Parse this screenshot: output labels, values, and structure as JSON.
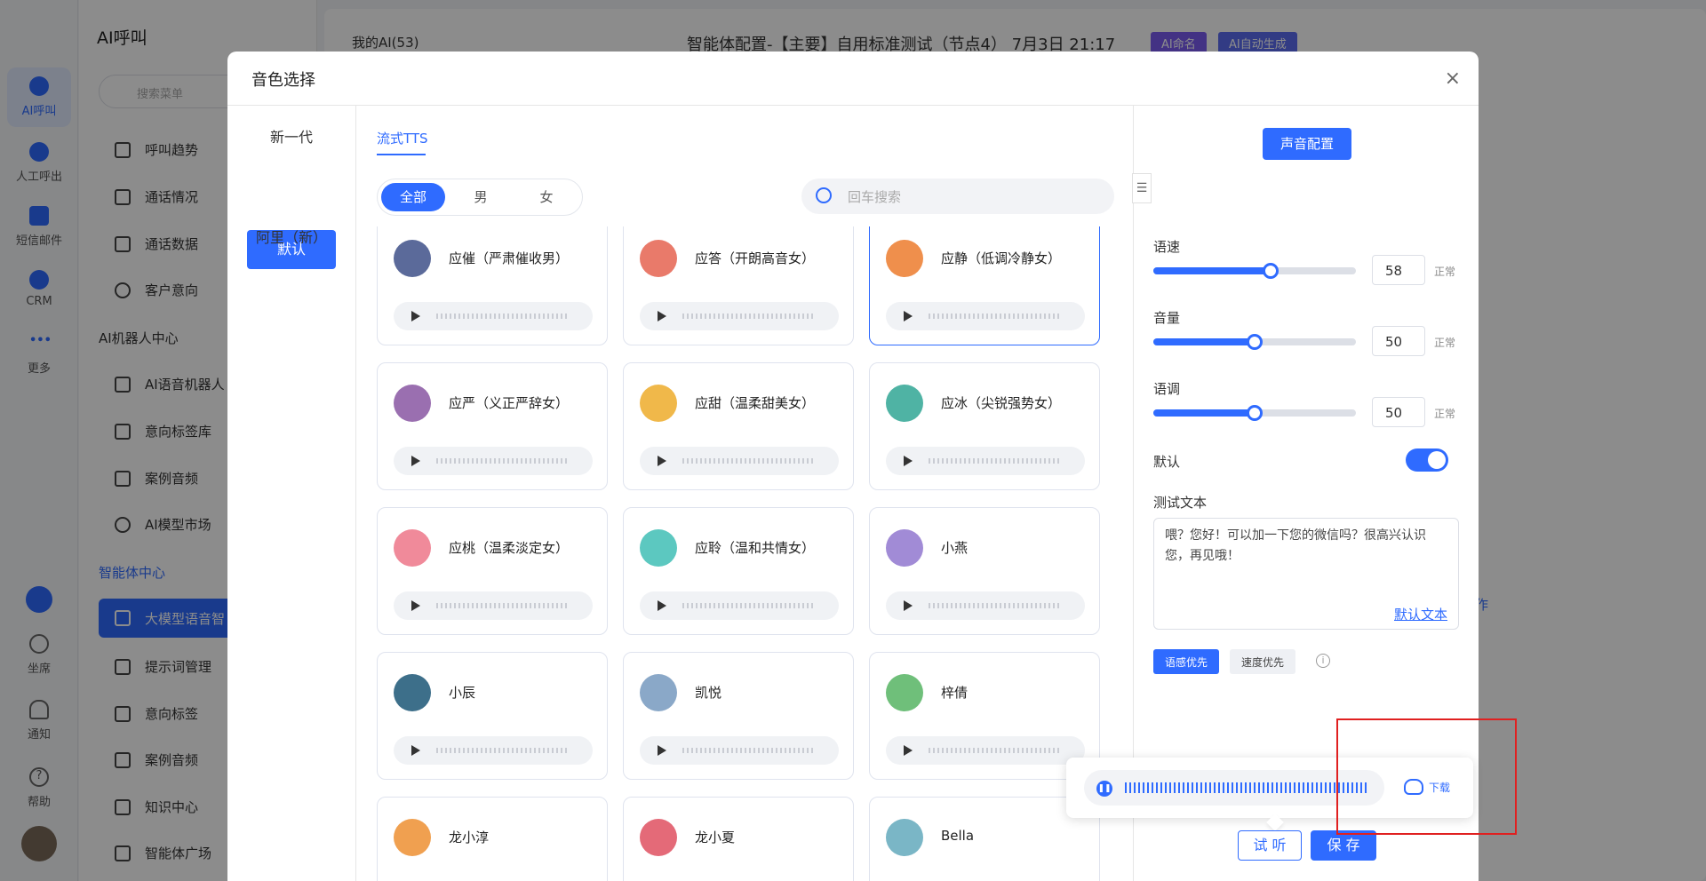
{
  "rail": [
    {
      "label": "AI呼叫",
      "active": true
    },
    {
      "label": "人工呼出"
    },
    {
      "label": "短信邮件"
    },
    {
      "label": "CRM"
    },
    {
      "label": "更多"
    },
    {
      "label": "坐席"
    },
    {
      "label": "通知"
    },
    {
      "label": "帮助"
    }
  ],
  "menu": {
    "title": "AI呼叫",
    "search_placeholder": "搜索菜单",
    "items": [
      "呼叫趋势",
      "通话情况",
      "通话数据",
      "客户意向"
    ],
    "group1": "AI机器人中心",
    "group1_items": [
      "AI语音机器人",
      "意向标签库",
      "案例音频",
      "AI模型市场"
    ],
    "group2": "智能体中心",
    "selected": "大模型语音智",
    "group2_items": [
      "提示词管理",
      "意向标签",
      "案例音频",
      "知识中心",
      "智能体广场"
    ]
  },
  "background": {
    "my_ai": "我的AI(53)",
    "title": "智能体配置-【主要】自用标准测试（节点4） 7月3日 21:17",
    "badge_name": "AI命名",
    "badge_gen": "AI自动生成",
    "partial_link": "作"
  },
  "modal": {
    "title": "音色选择",
    "close": "×",
    "left_items": [
      "新一代",
      "默认",
      "阿里（新）"
    ],
    "tab": "流式TTS",
    "segments": [
      "全部",
      "男",
      "女"
    ],
    "search_placeholder": "回车搜索",
    "voices": [
      {
        "name": "应催（严肃催收男）",
        "color": "#5b6a9a"
      },
      {
        "name": "应答（开朗高音女）",
        "color": "#e97a6a"
      },
      {
        "name": "应静（低调冷静女）",
        "color": "#ef8f4c"
      },
      {
        "name": "应严（义正严辞女）",
        "color": "#9a6fb0"
      },
      {
        "name": "应甜（温柔甜美女）",
        "color": "#f0b84a"
      },
      {
        "name": "应冰（尖锐强势女）",
        "color": "#4fb3a4"
      },
      {
        "name": "应桃（温柔淡定女）",
        "color": "#f08a9a"
      },
      {
        "name": "应聆（温和共情女）",
        "color": "#5cc8c0"
      },
      {
        "name": "小燕",
        "color": "#a18bd6"
      },
      {
        "name": "小辰",
        "color": "#3d6f8a"
      },
      {
        "name": "凯悦",
        "color": "#8aa8c8"
      },
      {
        "name": "梓倩",
        "color": "#6fbf7a"
      },
      {
        "name": "龙小淳",
        "color": "#f0a050"
      },
      {
        "name": "龙小夏",
        "color": "#e46a78"
      },
      {
        "name": "Bella",
        "color": "#7ab6c6"
      }
    ],
    "right": {
      "config_btn": "声音配置",
      "speed_label": "语速",
      "speed": 58,
      "volume_label": "音量",
      "volume": 50,
      "pitch_label": "语调",
      "pitch": 50,
      "normal": "正常",
      "default_label": "默认",
      "default_on": true,
      "test_text_label": "测试文本",
      "test_text": "喂？您好！可以加一下您的微信吗？很高兴认识您，再见哦！",
      "default_text_link": "默认文本",
      "mode_on": "语感优先",
      "mode_off": "速度优先",
      "info": "i"
    },
    "popup": {
      "download": "下载"
    },
    "try_btn": "试 听",
    "save_btn": "保 存"
  }
}
